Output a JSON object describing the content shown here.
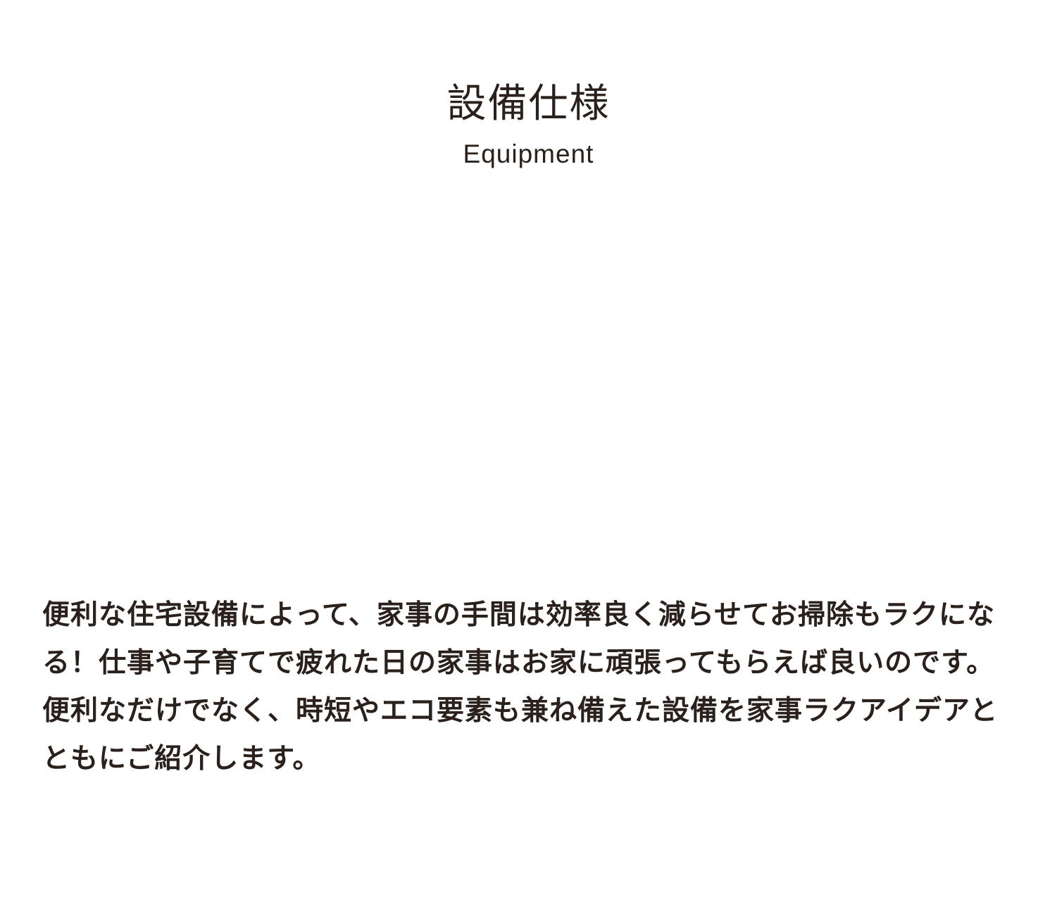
{
  "header": {
    "title_ja": "設備仕様",
    "title_en": "Equipment"
  },
  "description": "便利な住宅設備によって、家事の手間は効率良く減らせてお掃除もラクになる！仕事や子育てで疲れた日の家事はお家に頑張ってもらえば良いのです。便利なだけでなく、時短やエコ要素も兼ね備えた設備を家事ラクアイデアとともにご紹介します。"
}
